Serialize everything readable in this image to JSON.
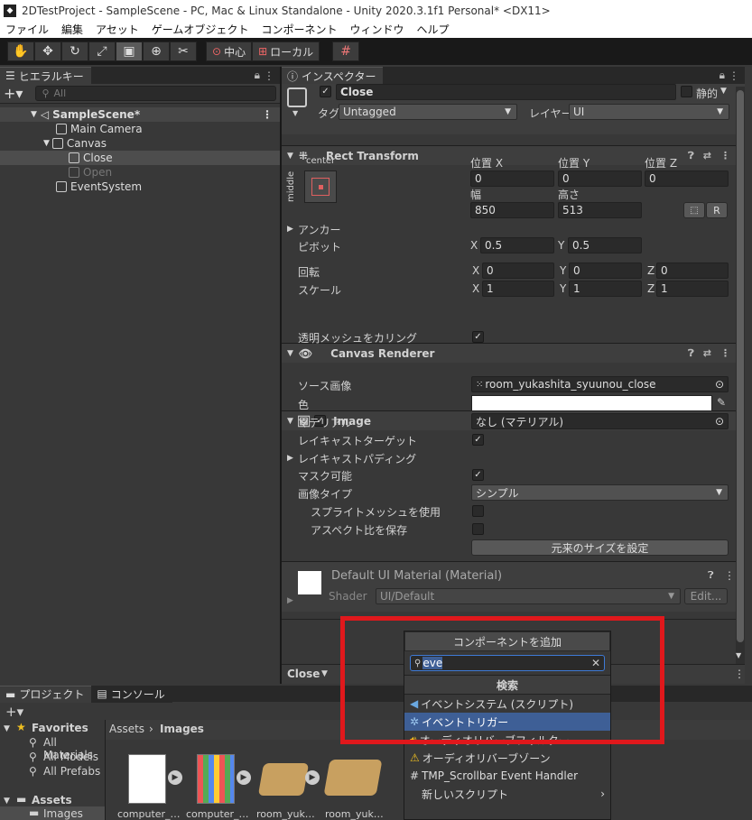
{
  "window": {
    "title": "2DTestProject - SampleScene - PC, Mac & Linux Standalone - Unity 2020.3.1f1 Personal* <DX11>"
  },
  "menubar": [
    "ファイル",
    "編集",
    "アセット",
    "ゲームオブジェクト",
    "コンポーネント",
    "ウィンドウ",
    "ヘルプ"
  ],
  "toolbar": {
    "pivot_label": "中心",
    "space_label": "ローカル"
  },
  "hierarchy": {
    "tab_label": "ヒエラルキー",
    "search_placeholder": "All",
    "items": [
      {
        "label": "SampleScene*",
        "depth": 0,
        "type": "scene"
      },
      {
        "label": "Main Camera",
        "depth": 1
      },
      {
        "label": "Canvas",
        "depth": 1,
        "expanded": true
      },
      {
        "label": "Close",
        "depth": 2,
        "selected": true
      },
      {
        "label": "Open",
        "depth": 2,
        "disabled": true
      },
      {
        "label": "EventSystem",
        "depth": 1
      }
    ]
  },
  "inspector": {
    "tab_label": "インスペクター",
    "object_name": "Close",
    "static_label": "静的",
    "tag_label": "タグ",
    "tag_value": "Untagged",
    "layer_label": "レイヤー",
    "layer_value": "UI",
    "rect_transform": {
      "title": "Rect Transform",
      "anchor_h": "center",
      "anchor_v": "middle",
      "pos_x_label": "位置 X",
      "pos_x": "0",
      "pos_y_label": "位置 Y",
      "pos_y": "0",
      "pos_z_label": "位置 Z",
      "pos_z": "0",
      "width_label": "幅",
      "width": "850",
      "height_label": "高さ",
      "height": "513",
      "r_button": "R",
      "anchor_label": "アンカー",
      "pivot_label": "ピボット",
      "pivot_x": "0.5",
      "pivot_y": "0.5",
      "rotation_label": "回転",
      "rot_x": "0",
      "rot_y": "0",
      "rot_z": "0",
      "scale_label": "スケール",
      "scale_x": "1",
      "scale_y": "1",
      "scale_z": "1",
      "x": "X",
      "y": "Y",
      "z": "Z"
    },
    "canvas_renderer": {
      "title": "Canvas Renderer",
      "cull_label": "透明メッシュをカリング"
    },
    "image": {
      "title": "Image",
      "source_label": "ソース画像",
      "source_value": "room_yukashita_syuunou_close",
      "color_label": "色",
      "material_label": "マテリアル",
      "material_value": "なし (マテリアル)",
      "raycast_target_label": "レイキャストターゲット",
      "raycast_padding_label": "レイキャストパディング",
      "maskable_label": "マスク可能",
      "image_type_label": "画像タイプ",
      "image_type_value": "シンプル",
      "use_sprite_mesh_label": "スプライトメッシュを使用",
      "preserve_aspect_label": "アスペクト比を保存",
      "set_native_size": "元来のサイズを設定"
    },
    "material": {
      "name": "Default UI Material (Material)",
      "shader_label": "Shader",
      "shader_value": "UI/Default",
      "edit_label": "Edit..."
    },
    "footer_object": "Close"
  },
  "add_component_popup": {
    "button_label": "コンポーネントを追加",
    "search_value": "eve",
    "section_title": "検索",
    "items": [
      {
        "label": "イベントシステム (スクリプト)",
        "icon": "event-system-icon"
      },
      {
        "label": "イベントトリガー",
        "icon": "event-trigger-icon",
        "highlighted": true
      },
      {
        "label": "オーディオリバーブフィルター",
        "icon": "audio-icon",
        "partial": true
      },
      {
        "label": "オーディオリバーブゾーン",
        "icon": "audio-zone-icon"
      },
      {
        "label": "TMP_Scrollbar Event Handler",
        "icon": "script-hash-icon"
      },
      {
        "label": "新しいスクリプト",
        "icon": "",
        "has_arrow": true
      }
    ]
  },
  "bottom": {
    "project_tab": "プロジェクト",
    "console_tab": "コンソール",
    "favorites_label": "Favorites",
    "favorites": [
      "All Materials",
      "All Models",
      "All Prefabs"
    ],
    "assets_label": "Assets",
    "images_label": "Images",
    "breadcrumb_root": "Assets",
    "breadcrumb_leaf": "Images",
    "thumbnails": [
      "computer_…",
      "computer_…",
      "room_yuk…",
      "room_yuk…"
    ]
  },
  "colors": {
    "highlight": "#3e5f96",
    "redbox": "#e0181c",
    "panel": "#383838"
  }
}
